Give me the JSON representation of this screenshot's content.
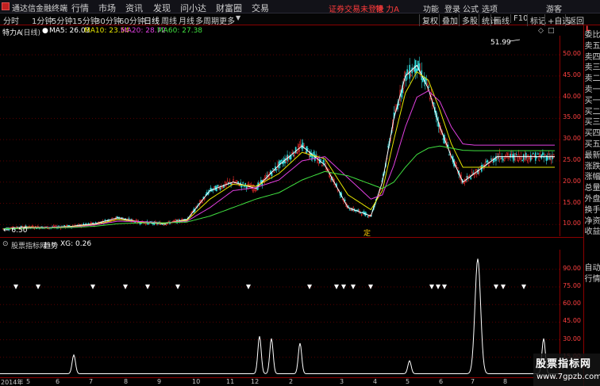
{
  "menubar": {
    "app_title": "通达信金融终端",
    "items": [
      "行情",
      "市场",
      "资讯",
      "发现",
      "问小达",
      "财富圈",
      "交易"
    ],
    "login_warning": "证券交易未登录",
    "stock_name": "特 力A",
    "right_items": [
      "功能",
      "登录",
      "公式",
      "选项",
      "游客"
    ]
  },
  "toolbar": {
    "periods": [
      "分时",
      "1分钟",
      "5分钟",
      "15分钟",
      "30分钟",
      "60分钟",
      "日线",
      "周线",
      "月线",
      "多周期",
      "更多"
    ],
    "active_period": "日线",
    "right_buttons": [
      "复权",
      "叠加",
      "多股",
      "统计",
      "画线",
      "F10",
      "标记",
      "+自选",
      "返回"
    ]
  },
  "infoline": {
    "name": "特力A",
    "period": "(日线)",
    "ma5": "MA5: 26.03",
    "ma10": "MA10: 23.54",
    "ma20": "MA20: 28.72",
    "ma60": "MA60: 27.38",
    "colors": {
      "ma5": "#ffffff",
      "ma10": "#e6e600",
      "ma20": "#e040e0",
      "ma60": "#40e040"
    }
  },
  "price_axis": {
    "ticks": [
      "50.00",
      "45.00",
      "40.00",
      "35.00",
      "30.00",
      "25.00",
      "20.00",
      "15.00",
      "10.00"
    ]
  },
  "annotations": {
    "high_label": "51.99",
    "low_label": "6.50",
    "marker_char": "定"
  },
  "indicator": {
    "source": "股票指标网",
    "name": "趋势",
    "value": "XG: 0.26",
    "ticks": [
      "90.00",
      "75.00",
      "60.00",
      "45.00",
      "30.00",
      "15.00"
    ]
  },
  "date_axis": {
    "labels": [
      "2014年",
      "5",
      "6",
      "7",
      "8",
      "9",
      "10",
      "11",
      "12",
      "2",
      "3",
      "4",
      "5",
      "6",
      "7",
      "8"
    ]
  },
  "sidepanel": {
    "badge": "L",
    "items": [
      "委比",
      "卖五",
      "卖四",
      "卖三",
      "卖二",
      "卖一",
      "买一",
      "买二",
      "买三",
      "买四",
      "买五",
      "最新",
      "涨跌",
      "涨幅",
      "总量",
      "外盘",
      "换手",
      "净资",
      "收益",
      "自动",
      "行情"
    ]
  },
  "watermark": {
    "title": "股票指标网",
    "url": "www.7gpzb.com"
  },
  "chart_data": {
    "type": "line",
    "title": "",
    "xlabel": "",
    "ylabel": "",
    "ylim": [
      8,
      53
    ],
    "x": [
      0,
      10,
      20,
      30,
      40,
      50,
      60,
      70,
      80,
      90,
      100,
      110,
      120,
      130,
      140,
      150,
      160,
      165,
      170,
      175,
      180,
      185,
      190,
      195,
      200,
      205,
      210,
      215,
      220,
      225,
      230,
      240
    ],
    "series": [
      {
        "name": "MA5",
        "color": "#ffffff",
        "values": [
          9.0,
          9.4,
          9.3,
          9.6,
          10.2,
          11.6,
          10.5,
          10.2,
          11.2,
          18,
          20,
          18.5,
          24,
          28.5,
          24,
          14,
          12,
          20,
          35,
          45,
          47.5,
          42,
          33,
          26,
          20,
          22,
          24,
          26,
          26,
          26,
          26,
          26
        ]
      },
      {
        "name": "MA10",
        "color": "#e6e600",
        "values": [
          9.0,
          9.3,
          9.3,
          9.5,
          10.0,
          11.2,
          10.6,
          10.3,
          11.0,
          16,
          19.5,
          19,
          22,
          27,
          25.5,
          17,
          13.5,
          18,
          30,
          41,
          46,
          44,
          37,
          29,
          23.5,
          23.5,
          23.5,
          23.5,
          23.5,
          23.5,
          23.5,
          23.5
        ]
      },
      {
        "name": "MA20",
        "color": "#e040e0",
        "values": [
          9.0,
          9.2,
          9.3,
          9.4,
          9.9,
          10.8,
          10.7,
          10.4,
          10.8,
          14,
          18,
          18.7,
          20.5,
          25,
          26,
          21,
          16,
          17,
          24,
          33,
          40,
          41.5,
          39,
          33,
          29,
          28.7,
          28.7,
          28.7,
          28.7,
          28.7,
          28.7,
          28.7
        ]
      },
      {
        "name": "MA60",
        "color": "#40e040",
        "values": [
          9.0,
          9.1,
          9.2,
          9.3,
          9.6,
          10.2,
          10.4,
          10.4,
          10.6,
          12,
          14,
          16,
          17.5,
          20.5,
          22.5,
          21.5,
          19.5,
          18.5,
          20,
          23.5,
          26.5,
          28,
          28.5,
          28,
          27.5,
          27.4,
          27.4,
          27.4,
          27.4,
          27.4,
          27.4,
          27.4
        ]
      }
    ],
    "indicator_series": {
      "name": "XG",
      "ylim": [
        0,
        100
      ],
      "peaks": [
        {
          "x": 93,
          "value": 16
        },
        {
          "x": 327,
          "value": 32
        },
        {
          "x": 342,
          "value": 30
        },
        {
          "x": 378,
          "value": 26
        },
        {
          "x": 516,
          "value": 11
        },
        {
          "x": 602,
          "value": 98
        },
        {
          "x": 685,
          "value": 30
        }
      ],
      "signal_x": [
        20,
        48,
        117,
        158,
        186,
        224,
        313,
        390,
        424,
        433,
        445,
        467,
        544,
        552,
        560,
        625,
        634,
        660
      ]
    }
  }
}
